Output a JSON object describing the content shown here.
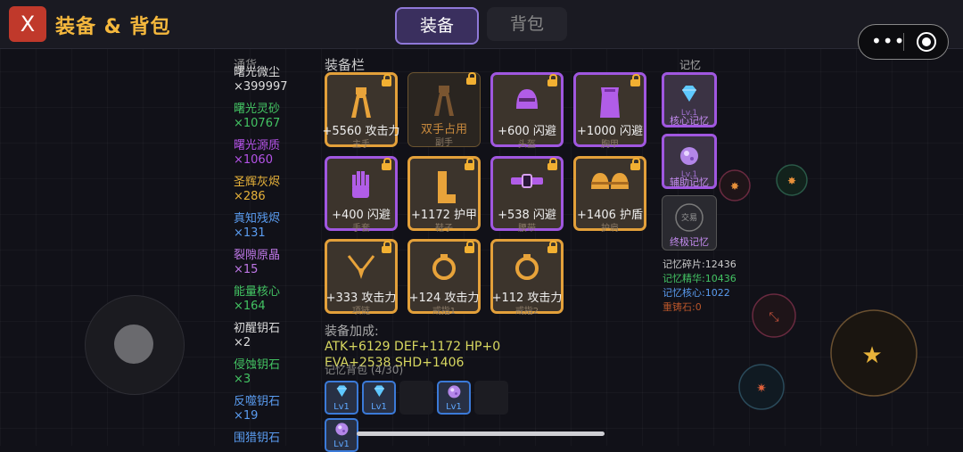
{
  "header": {
    "close_label": "X",
    "title": "装备 & 背包",
    "tab_equip": "装备",
    "tab_bag": "背包",
    "menu_dots": "•••"
  },
  "currency": {
    "header": "通货",
    "items": [
      {
        "name": "曙光微尘",
        "qty": "×399997",
        "color": "#dddddd"
      },
      {
        "name": "曙光灵砂",
        "qty": "×10767",
        "color": "#43c463"
      },
      {
        "name": "曙光源质",
        "qty": "×1060",
        "color": "#b553e8"
      },
      {
        "name": "圣辉灰烬",
        "qty": "×286",
        "color": "#e8b33a"
      },
      {
        "name": "真知残烬",
        "qty": "×131",
        "color": "#5a9cf0"
      },
      {
        "name": "裂隙原晶",
        "qty": "×15",
        "color": "#c078e8"
      },
      {
        "name": "能量核心",
        "qty": "×164",
        "color": "#43c463"
      },
      {
        "name": "初醒钥石",
        "qty": "×2",
        "color": "#dddddd"
      },
      {
        "name": "侵蚀钥石",
        "qty": "×3",
        "color": "#43c463"
      },
      {
        "name": "反噬钥石",
        "qty": "×19",
        "color": "#5a9cf0"
      },
      {
        "name": "围猎钥石",
        "qty": "",
        "color": "#5a9cf0"
      }
    ]
  },
  "equipment": {
    "title": "装备栏",
    "slots": [
      {
        "stat": "+5560 攻击力",
        "label": "主手",
        "rarity": "gold",
        "icon": "sword-icon"
      },
      {
        "stat": "双手占用",
        "label": "副手",
        "rarity": "dim",
        "icon": "offhand-icon"
      },
      {
        "stat": "+600 闪避",
        "label": "头盔",
        "rarity": "purple",
        "icon": "helmet-icon"
      },
      {
        "stat": "+1000 闪避",
        "label": "胸甲",
        "rarity": "purple",
        "icon": "chest-armor-icon"
      },
      {
        "stat": "+400 闪避",
        "label": "手套",
        "rarity": "purple",
        "icon": "glove-icon"
      },
      {
        "stat": "+1172 护甲",
        "label": "鞋子",
        "rarity": "gold",
        "icon": "boot-icon"
      },
      {
        "stat": "+538 闪避",
        "label": "腰带",
        "rarity": "purple",
        "icon": "belt-icon"
      },
      {
        "stat": "+1406 护盾",
        "label": "护肩",
        "rarity": "gold",
        "icon": "shoulder-icon"
      },
      {
        "stat": "+333 攻击力",
        "label": "项链",
        "rarity": "gold",
        "icon": "necklace-icon"
      },
      {
        "stat": "+124 攻击力",
        "label": "戒指1",
        "rarity": "gold",
        "icon": "ring-icon"
      },
      {
        "stat": "+112 攻击力",
        "label": "戒指2",
        "rarity": "gold",
        "icon": "ring-icon"
      }
    ]
  },
  "bonus": {
    "title": "装备加成:",
    "line1": "ATK+6129  DEF+1172  HP+0",
    "line2": "EVA+2538  SHD+1406"
  },
  "memory_bag": {
    "title": "记忆背包 (4/30)",
    "cells": [
      {
        "lv": "Lv1",
        "icon": "diamond-icon"
      },
      {
        "lv": "Lv1",
        "icon": "diamond-icon"
      },
      {
        "lv": "",
        "icon": ""
      },
      {
        "lv": "Lv1",
        "icon": "orb-icon"
      },
      {
        "lv": "",
        "icon": ""
      }
    ],
    "row2": [
      {
        "lv": "Lv1",
        "icon": "orb-icon"
      }
    ]
  },
  "memory": {
    "title": "记忆",
    "slots": [
      {
        "label": "核心记忆",
        "level": "Lv.1",
        "icon": "diamond-icon"
      },
      {
        "label": "辅助记忆",
        "level": "Lv.1",
        "icon": "orb-icon"
      },
      {
        "label": "终极记忆",
        "level": "",
        "icon": "trade-icon",
        "inner": "交易"
      }
    ],
    "stats": [
      {
        "text": "记忆碎片:12436",
        "color": "#cccccc"
      },
      {
        "text": "记忆精华:10436",
        "color": "#43c463"
      },
      {
        "text": "记忆核心:1022",
        "color": "#5a9cf0"
      },
      {
        "text": "重铸石:0",
        "color": "#b8552a"
      }
    ]
  }
}
